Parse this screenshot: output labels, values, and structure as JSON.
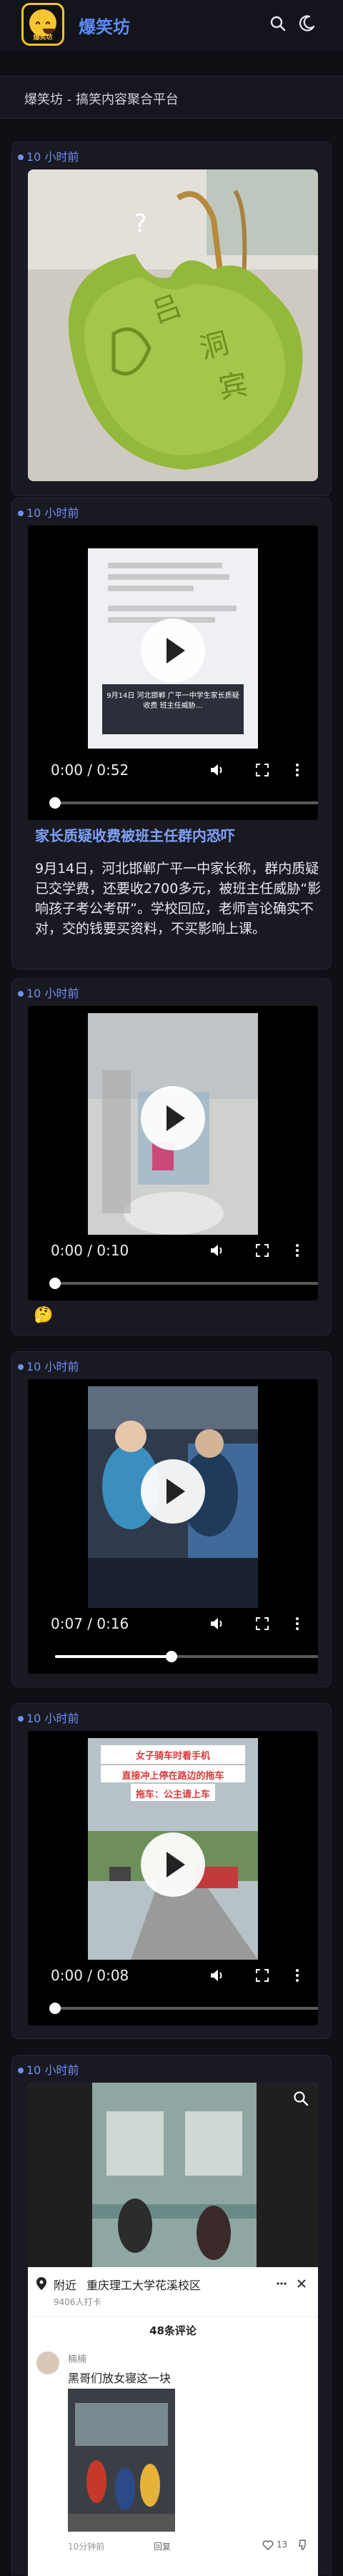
{
  "header": {
    "logo_text": "爆笑坊",
    "site_title": "爆笑坊",
    "search_icon": "search-icon",
    "theme_icon": "moon-icon"
  },
  "subheader": {
    "title": "爆笑坊 - 搞笑内容聚合平台"
  },
  "posts": [
    {
      "time": "10 小时前",
      "type": "image"
    },
    {
      "time": "10 小时前",
      "type": "video",
      "player_time": "0:00 / 0:52",
      "progress": 0,
      "title": "家长质疑收费被班主任群内恐吓",
      "body": "9月14日，河北邯郸广平一中家长称，群内质疑已交学费，还要收2700多元，被班主任威胁“影响孩子考公考研”。学校回应，老师言论确实不对，交的钱要买资料，不买影响上课。",
      "thumb_caption": "9月14日 河北邯郸 广平一中学生家长质疑收费 班主任威胁…"
    },
    {
      "time": "10 小时前",
      "type": "video",
      "player_time": "0:00 / 0:10",
      "progress": 0,
      "reaction_emoji": "🤔"
    },
    {
      "time": "10 小时前",
      "type": "video",
      "player_time": "0:07 / 0:16",
      "progress": 0.44
    },
    {
      "time": "10 小时前",
      "type": "video",
      "player_time": "0:00 / 0:08",
      "progress": 0,
      "thumb_caption_1": "女子骑车时看手机",
      "thumb_caption_2": "直接冲上停在路边的拖车",
      "thumb_caption_3": "拖车：公主请上车"
    },
    {
      "time": "10 小时前",
      "type": "screenshot",
      "location_label": "附近",
      "location_name": "重庆理工大学花溪校区",
      "location_sub": "9406人打卡",
      "comments_header": "48条评论",
      "commenter": "楠楠",
      "comment_text": "黑哥们放女寝这一块",
      "comment_meta": "10分钟前",
      "comment_reply": "回复",
      "like_count": "13"
    }
  ],
  "colors": {
    "accent": "#5b8df2",
    "background": "#0f0f16",
    "card": "#191922"
  }
}
